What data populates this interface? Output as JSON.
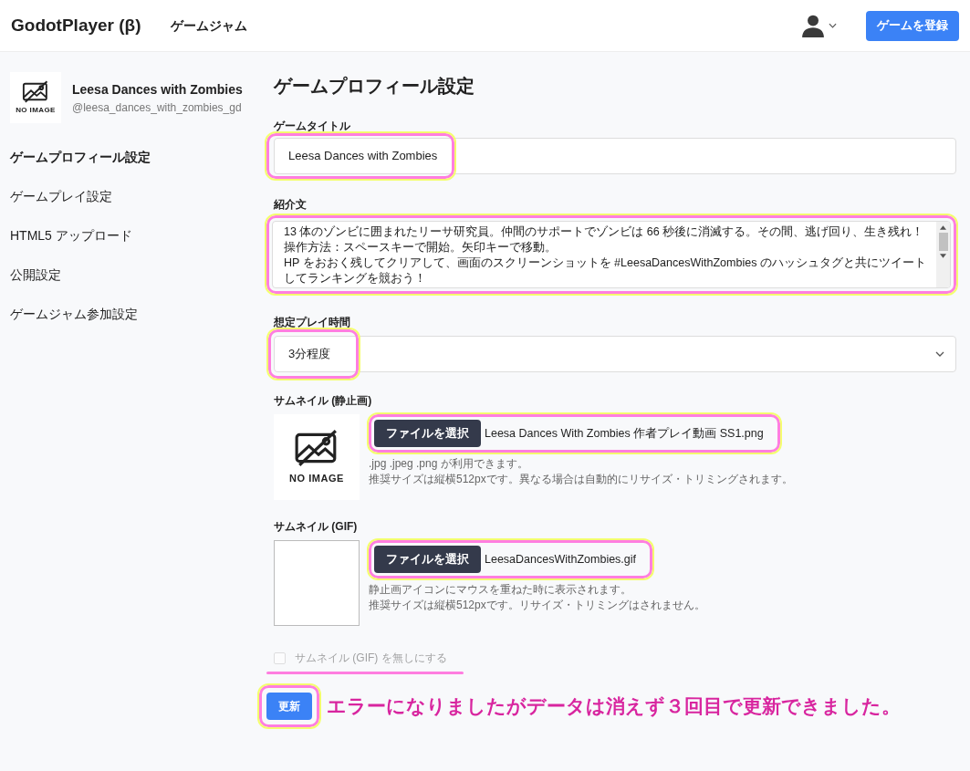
{
  "header": {
    "brand": "GodotPlayer (β)",
    "nav_link": "ゲームジャム",
    "register_button": "ゲームを登録"
  },
  "sidebar": {
    "game_name": "Leesa Dances with Zombies",
    "handle": "@leesa_dances_with_zombies_gd",
    "thumb_label": "NO IMAGE",
    "items": [
      {
        "label": "ゲームプロフィール設定",
        "selected": true
      },
      {
        "label": "ゲームプレイ設定",
        "selected": false
      },
      {
        "label": "HTML5 アップロード",
        "selected": false
      },
      {
        "label": "公開設定",
        "selected": false
      },
      {
        "label": "ゲームジャム参加設定",
        "selected": false
      }
    ]
  },
  "page_title": "ゲームプロフィール設定",
  "fields": {
    "title_label": "ゲームタイトル",
    "title_value": "Leesa Dances with Zombies",
    "intro_label": "紹介文",
    "intro_lines": [
      "13 体のゾンビに囲まれたリーサ研究員。仲間のサポートでゾンビは 66 秒後に消滅する。その間、逃げ回り、生き残れ！",
      "操作方法：スペースキーで開始。矢印キーで移動。",
      "HP をおおく残してクリアして、画面のスクリーンショットを #LeesaDancesWithZombies のハッシュタグと共にツイート",
      "してランキングを競おう！"
    ],
    "playtime_label": "想定プレイ時間",
    "playtime_value": "3分程度"
  },
  "thumbnails": [
    {
      "kind": "still",
      "label": "サムネイル (静止画)",
      "preview_label": "NO IMAGE",
      "choose_button": "ファイルを選択",
      "file_name": "Leesa Dances With Zombies 作者プレイ動画 SS1.png",
      "hints": [
        ".jpg .jpeg .png が利用できます。",
        "推奨サイズは縦横512pxです。異なる場合は自動的にリサイズ・トリミングされます。"
      ]
    },
    {
      "kind": "gif",
      "label": "サムネイル (GIF)",
      "choose_button": "ファイルを選択",
      "file_name": "LeesaDancesWithZombies.gif",
      "hints": [
        "静止画アイコンにマウスを重ねた時に表示されます。",
        "推奨サイズは縦横512pxです。リサイズ・トリミングはされません。"
      ]
    }
  ],
  "no_gif": {
    "label": "サムネイル (GIF) を無しにする",
    "checked": false,
    "disabled": true
  },
  "submit_button": "更新",
  "annotation": "エラーになりましたがデータは消えず３回目で更新できました。"
}
